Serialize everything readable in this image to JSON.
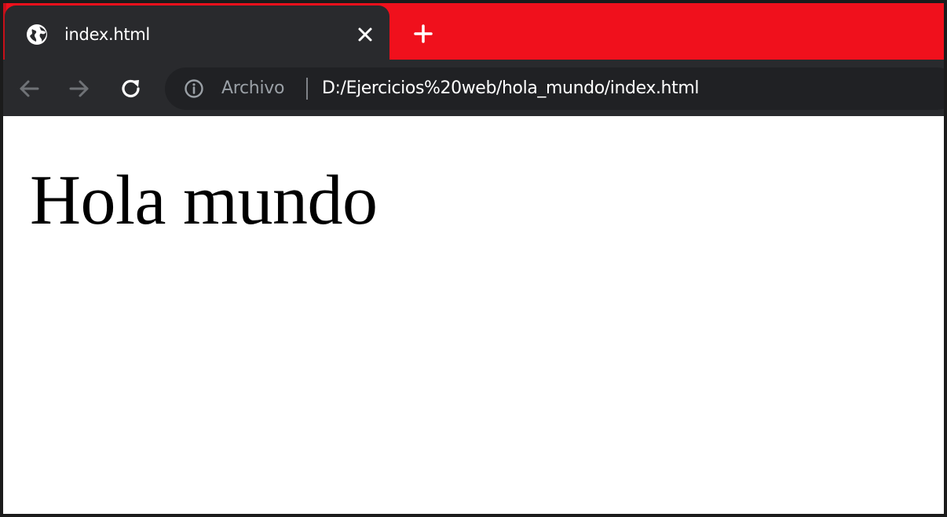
{
  "browser": {
    "theme": {
      "frame_color": "#f0101c",
      "tab_color": "#292a2d",
      "toolbar_color": "#292a2d",
      "omnibox_color": "#202124"
    },
    "tab": {
      "title": "index.html",
      "favicon": "globe-icon",
      "close_icon": "close-icon"
    },
    "new_tab_icon": "plus-icon",
    "nav": {
      "back_icon": "arrow-left-icon",
      "forward_icon": "arrow-right-icon",
      "reload_icon": "reload-icon"
    },
    "omnibox": {
      "security_icon": "info-icon",
      "scheme_label": "Archivo",
      "url": "D:/Ejercicios%20web/hola_mundo/index.html"
    }
  },
  "page": {
    "heading": "Hola mundo"
  }
}
